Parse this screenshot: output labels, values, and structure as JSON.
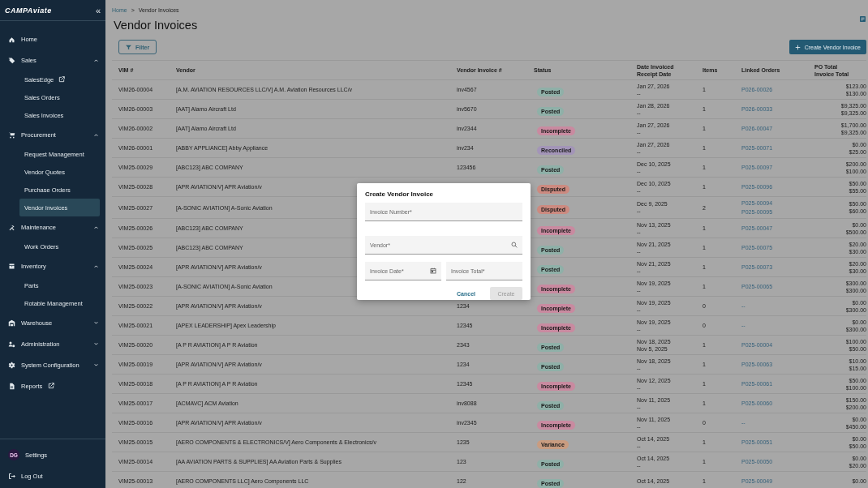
{
  "sidebar": {
    "logo": "CAMPAviate",
    "collapse_glyph": "«",
    "items": [
      {
        "label": "Home"
      },
      {
        "label": "Sales",
        "expanded": true,
        "children": [
          {
            "label": "SalesEdge",
            "external": true,
            "selected": false
          },
          {
            "label": "Sales Orders",
            "selected": false
          },
          {
            "label": "Sales Invoices",
            "selected": false
          }
        ]
      },
      {
        "label": "Procurement",
        "expanded": true,
        "children": [
          {
            "label": "Request Management",
            "selected": false
          },
          {
            "label": "Vendor Quotes",
            "selected": false
          },
          {
            "label": "Purchase Orders",
            "selected": false
          },
          {
            "label": "Vendor Invoices",
            "selected": true
          }
        ]
      },
      {
        "label": "Maintenance",
        "expanded": true,
        "children": [
          {
            "label": "Work Orders",
            "selected": false
          }
        ]
      },
      {
        "label": "Inventory",
        "expanded": true,
        "children": [
          {
            "label": "Parts",
            "selected": false
          },
          {
            "label": "Rotable Management",
            "selected": false
          }
        ]
      },
      {
        "label": "Warehouse",
        "expanded": false
      },
      {
        "label": "Administration",
        "expanded": false
      },
      {
        "label": "System Configuration",
        "expanded": false
      },
      {
        "label": "Reports",
        "external": true
      }
    ],
    "footer": [
      {
        "label": "Settings",
        "avatar": "DG"
      },
      {
        "label": "Log Out"
      }
    ]
  },
  "breadcrumb": [
    "Home",
    "Vendor Invoices"
  ],
  "breadcrumb_separator": ">",
  "title": "Vendor Invoices",
  "filter_button": "Filter",
  "create_button": "Create Vendor Invoice",
  "table": {
    "columns": [
      "VIM #",
      "Vendor",
      "Vendor Invoice #",
      "Status",
      [
        "Date Invoiced",
        "Receipt Date"
      ],
      "Items",
      "Linked Orders",
      [
        "PO Total",
        "Invoice Total"
      ]
    ],
    "rows": [
      {
        "vim": "VIM26-00004",
        "vendor": "[A.M. AVIATION RESOURCES LLC/V] A.M. Aviation Resources LLC/v",
        "vendor_invoice": "inv4567",
        "status": {
          "label": "Posted",
          "color": "#8fb0a8"
        },
        "date_invoiced": "Jan 27, 2026",
        "receipt_date": "--",
        "items": "1",
        "linked_orders": [
          "P026-00026"
        ],
        "po_total": "$123.00",
        "invoice_total": "$130.00"
      },
      {
        "vim": "VIM26-00003",
        "vendor": "[AAT] Alamo Aircraft Ltd",
        "vendor_invoice": "inv5670",
        "status": {
          "label": "Posted",
          "color": "#8fb0a8"
        },
        "date_invoiced": "Jan 28, 2026",
        "receipt_date": "--",
        "items": "1",
        "linked_orders": [
          "P026-00033"
        ],
        "po_total": "$9,325.00",
        "invoice_total": "$9,325.00"
      },
      {
        "vim": "VIM26-00002",
        "vendor": "[AAT] Alamo Aircraft Ltd",
        "vendor_invoice": "inv2344",
        "status": {
          "label": "Incomplete",
          "color": "#c98aa0"
        },
        "date_invoiced": "Jan 27, 2026",
        "receipt_date": "--",
        "items": "1",
        "linked_orders": [
          "P026-00047"
        ],
        "po_total": "$1,700.00",
        "invoice_total": "$9,325.00"
      },
      {
        "vim": "VIM26-00001",
        "vendor": "[ABBY APPLIANCE] Abby Appliance",
        "vendor_invoice": "inv234",
        "status": {
          "label": "Reconciled",
          "color": "#a395b8"
        },
        "date_invoiced": "Jan 27, 2026",
        "receipt_date": "--",
        "items": "1",
        "linked_orders": [
          "P025-00071"
        ],
        "po_total": "$0.00",
        "invoice_total": "$25.00"
      },
      {
        "vim": "VIM25-00029",
        "vendor": "[ABC123] ABC COMPANY",
        "vendor_invoice": "123456",
        "status": {
          "label": "Posted",
          "color": "#8fb0a8"
        },
        "date_invoiced": "Dec 10, 2025",
        "receipt_date": "--",
        "items": "1",
        "linked_orders": [
          "P025-00097"
        ],
        "po_total": "$200.00",
        "invoice_total": "$100.00"
      },
      {
        "vim": "VIM25-00028",
        "vendor": "[APR AVIATION/V] APR Aviation/v",
        "status": {
          "label": "Disputed",
          "color": "#cc8a80"
        },
        "date_invoiced": "Dec 10, 2025",
        "receipt_date": "--",
        "items": "1",
        "linked_orders": [
          "P025-00096"
        ],
        "po_total": "$50.00",
        "invoice_total": "$55.00"
      },
      {
        "vim": "VIM25-00027",
        "vendor": "[A-SONIC AVIATION] A-Sonic Aviation",
        "status": {
          "label": "Disputed",
          "color": "#cc8a80"
        },
        "date_invoiced": "Dec 9, 2025",
        "receipt_date": "--",
        "items": "2",
        "linked_orders": [
          "P025-00094",
          "P025-00095"
        ],
        "po_total": "$50.00",
        "invoice_total": "$60.00"
      },
      {
        "vim": "VIM25-00026",
        "vendor": "[ABC123] ABC COMPANY",
        "status": {
          "label": "Incomplete",
          "color": "#c98aa0"
        },
        "date_invoiced": "Nov 13, 2025",
        "receipt_date": "--",
        "items": "1",
        "linked_orders": [
          "P025-00047"
        ],
        "po_total": "$0.00",
        "invoice_total": "$500.00"
      },
      {
        "vim": "VIM25-00025",
        "vendor": "[ABC123] ABC COMPANY",
        "status": {
          "label": "Posted",
          "color": "#8fb0a8"
        },
        "date_invoiced": "Nov 21, 2025",
        "receipt_date": "--",
        "items": "1",
        "linked_orders": [
          "P025-00075"
        ],
        "po_total": "$20.00",
        "invoice_total": "$30.00"
      },
      {
        "vim": "VIM25-00024",
        "vendor": "[APR AVIATION/V] APR Aviation/v",
        "status": {
          "label": "Posted",
          "color": "#8fb0a8"
        },
        "date_invoiced": "Nov 21, 2025",
        "receipt_date": "--",
        "items": "1",
        "linked_orders": [
          "P025-00073"
        ],
        "po_total": "$20.00",
        "invoice_total": "$30.00"
      },
      {
        "vim": "VIM25-00023",
        "vendor": "[A-SONIC AVIATION] A-Sonic Aviation",
        "status": {
          "label": "Incomplete",
          "color": "#c98aa0"
        },
        "date_invoiced": "Nov 19, 2025",
        "receipt_date": "--",
        "items": "1",
        "linked_orders": [
          "P025-00065"
        ],
        "po_total": "$300.00",
        "invoice_total": "$300.00"
      },
      {
        "vim": "VIM25-00022",
        "vendor": "[APR AVIATION/V] APR Aviation/v",
        "vendor_invoice": "1234",
        "status": {
          "label": "Incomplete",
          "color": "#c98aa0"
        },
        "date_invoiced": "Nov 19, 2025",
        "receipt_date": "--",
        "items": "0",
        "linked_orders": [
          "--"
        ],
        "po_total": "$0.00",
        "invoice_total": "$300.00"
      },
      {
        "vim": "VIM25-00021",
        "vendor": "[APEX LEADERSHIP] Apex Leadership",
        "vendor_invoice": "12345",
        "status": {
          "label": "Incomplete",
          "color": "#c98aa0"
        },
        "date_invoiced": "Nov 19, 2025",
        "receipt_date": "--",
        "items": "0",
        "linked_orders": [
          "--"
        ],
        "po_total": "$0.00",
        "invoice_total": "$300.00"
      },
      {
        "vim": "VIM25-00020",
        "vendor": "[A P R AVIATION] A P R Aviation",
        "vendor_invoice": "2343",
        "status": {
          "label": "Posted",
          "color": "#8fb0a8"
        },
        "date_invoiced": "Nov 18, 2025",
        "receipt_date": "Nov 5, 2025",
        "items": "1",
        "linked_orders": [
          "P025-00004"
        ],
        "po_total": "$100.00",
        "invoice_total": "$50.00"
      },
      {
        "vim": "VIM25-00019",
        "vendor": "[APR AVIATION/V] APR Aviation/v",
        "vendor_invoice": "1234",
        "status": {
          "label": "Posted",
          "color": "#8fb0a8"
        },
        "date_invoiced": "Nov 18, 2025",
        "receipt_date": "--",
        "items": "1",
        "linked_orders": [
          "P025-00063"
        ],
        "po_total": "$10.00",
        "invoice_total": "$15.00"
      },
      {
        "vim": "VIM25-00018",
        "vendor": "[A P R AVIATION] A P R Aviation",
        "vendor_invoice": "12345",
        "status": {
          "label": "Incomplete",
          "color": "#c98aa0"
        },
        "date_invoiced": "Nov 12, 2025",
        "receipt_date": "--",
        "items": "1",
        "linked_orders": [
          "P025-00061"
        ],
        "po_total": "$50.00",
        "invoice_total": "$100.00"
      },
      {
        "vim": "VIM25-00017",
        "vendor": "[ACMAVC] ACM Aviation",
        "vendor_invoice": "inv8088",
        "status": {
          "label": "Posted",
          "color": "#8fb0a8"
        },
        "date_invoiced": "Nov 11, 2025",
        "receipt_date": "--",
        "items": "1",
        "linked_orders": [
          "P025-00060"
        ],
        "po_total": "$150.00",
        "invoice_total": "$200.00"
      },
      {
        "vim": "VIM25-00016",
        "vendor": "[APR AVIATION/V] APR Aviation/v",
        "vendor_invoice": "inv2345",
        "status": {
          "label": "Incomplete",
          "color": "#c98aa0"
        },
        "date_invoiced": "Nov 11, 2025",
        "receipt_date": "--",
        "items": "0",
        "linked_orders": [
          "--"
        ],
        "po_total": "$0.00",
        "invoice_total": "$450.00"
      },
      {
        "vim": "VIM25-00015",
        "vendor": "[AERO COMPONENTS & ELECTRONICS/V] Aero Components & Electronics/v",
        "vendor_invoice": "1235",
        "status": {
          "label": "Variance",
          "color": "#c99c80"
        },
        "date_invoiced": "Oct 14, 2025",
        "receipt_date": "--",
        "items": "1",
        "linked_orders": [
          "P025-00051"
        ],
        "po_total": "$0.00",
        "invoice_total": "$50.00"
      },
      {
        "vim": "VIM25-00014",
        "vendor": "[AA AVIATION PARTS & SUPPLIES] AA Aviation Parts & Supplies",
        "vendor_invoice": "123",
        "status": {
          "label": "Posted",
          "color": "#8fb0a8"
        },
        "date_invoiced": "Oct 14, 2025",
        "receipt_date": "--",
        "items": "1",
        "linked_orders": [
          "P025-00050"
        ],
        "po_total": "$0.00",
        "invoice_total": "$20.00"
      },
      {
        "vim": "VIM25-00013",
        "vendor": "[AERO COMPONENTS LLC] Aero Components LLC",
        "vendor_invoice": "122",
        "status": {
          "label": "Posted",
          "color": "#8fb0a8"
        },
        "date_invoiced": "Oct 14, 2025",
        "items": "1",
        "linked_orders": [
          "P025-00049"
        ],
        "po_total": "$0.00"
      }
    ]
  },
  "dialog": {
    "title": "Create Vendor Invoice",
    "fields": [
      {
        "placeholder": "Invoice Number*",
        "kind": "text"
      },
      {
        "placeholder": "Vendor*",
        "kind": "search"
      },
      {
        "placeholder": "Invoice Date*",
        "kind": "date"
      },
      {
        "placeholder": "Invoice Total*",
        "kind": "text"
      }
    ],
    "cancel": "Cancel",
    "create": {
      "label": "Create",
      "disabled": true
    }
  }
}
